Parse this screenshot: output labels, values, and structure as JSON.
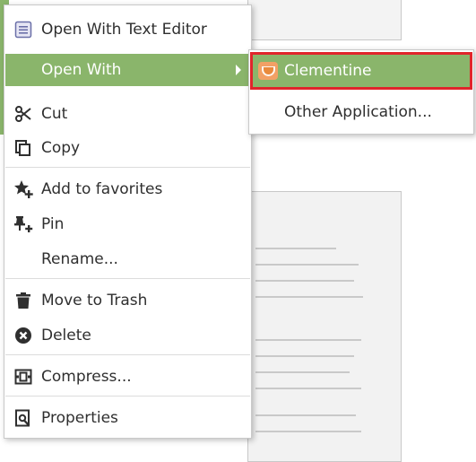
{
  "menu": {
    "items": [
      {
        "label": "Open With Text Editor",
        "icon": "text-editor-icon"
      },
      {
        "label": "Open With",
        "icon": ""
      },
      {
        "label": "Cut",
        "icon": "scissors-icon"
      },
      {
        "label": "Copy",
        "icon": "copy-icon"
      },
      {
        "label": "Add to favorites",
        "icon": "star-add-icon"
      },
      {
        "label": "Pin",
        "icon": "pin-icon"
      },
      {
        "label": "Rename...",
        "icon": ""
      },
      {
        "label": "Move to Trash",
        "icon": "trash-icon"
      },
      {
        "label": "Delete",
        "icon": "delete-circle-icon"
      },
      {
        "label": "Compress...",
        "icon": "compress-icon"
      },
      {
        "label": "Properties",
        "icon": "properties-icon"
      }
    ]
  },
  "submenu": {
    "items": [
      {
        "label": "Clementine",
        "icon": "clementine-app-icon"
      },
      {
        "label": "Other Application..."
      }
    ]
  },
  "colors": {
    "accent": "#8ab56b",
    "highlight_border": "#e0252b",
    "text": "#2f2f2f"
  }
}
